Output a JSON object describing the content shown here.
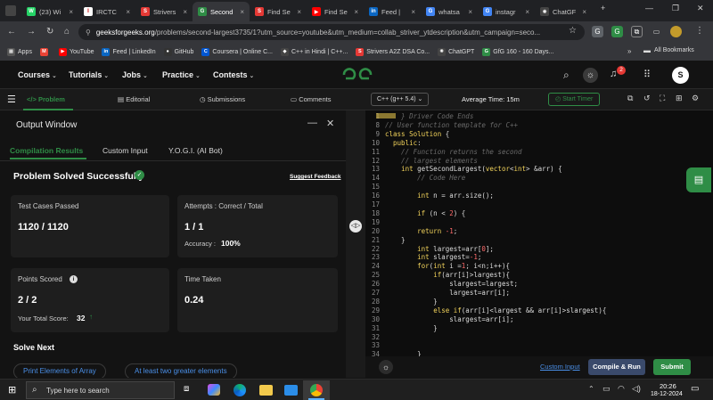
{
  "browser": {
    "tabs": [
      {
        "label": "(23) Wi",
        "color": "#25d366",
        "glyph": "W"
      },
      {
        "label": "IRCTC",
        "color": "#ffffff",
        "glyph": "I"
      },
      {
        "label": "Strivers",
        "color": "#e53935",
        "glyph": "S"
      },
      {
        "label": "Second",
        "color": "#2f8d46",
        "glyph": "G",
        "active": true
      },
      {
        "label": "Find Se",
        "color": "#e53935",
        "glyph": "S"
      },
      {
        "label": "Find Se",
        "color": "#ff0000",
        "glyph": "▶"
      },
      {
        "label": "Feed | ",
        "color": "#0a66c2",
        "glyph": "in"
      },
      {
        "label": "whatsa",
        "color": "#4285f4",
        "glyph": "G"
      },
      {
        "label": "instagr",
        "color": "#4285f4",
        "glyph": "G"
      },
      {
        "label": "ChatGF",
        "color": "#444444",
        "glyph": "✺"
      }
    ],
    "url_domain": "geeksforgeeks.org",
    "url_rest": "/problems/second-largest3735/1?utm_source=youtube&utm_medium=collab_striver_ytdescription&utm_campaign=seco...",
    "bookmarks": [
      {
        "label": "Apps",
        "color": "#555555",
        "glyph": "▦"
      },
      {
        "label": "",
        "color": "#ea4335",
        "glyph": "M"
      },
      {
        "label": "YouTube",
        "color": "#ff0000",
        "glyph": "▶"
      },
      {
        "label": "Feed | LinkedIn",
        "color": "#0a66c2",
        "glyph": "in"
      },
      {
        "label": "GitHub",
        "color": "#333333",
        "glyph": "●"
      },
      {
        "label": "Coursera | Online C...",
        "color": "#0056d2",
        "glyph": "C"
      },
      {
        "label": "C++ in Hindi | C++...",
        "color": "#444444",
        "glyph": "◆"
      },
      {
        "label": "Strivers A2Z DSA Co...",
        "color": "#e53935",
        "glyph": "S"
      },
      {
        "label": "ChatGPT",
        "color": "#444444",
        "glyph": "✺"
      },
      {
        "label": "GfG 160 - 160 Days...",
        "color": "#2f8d46",
        "glyph": "G"
      }
    ],
    "all_bookmarks": "All Bookmarks"
  },
  "gfg_header": {
    "menus": [
      "Courses",
      "Tutorials",
      "Jobs",
      "Practice",
      "Contests"
    ],
    "logo": "GG",
    "notif_count": "2",
    "avatar": "S"
  },
  "toolbar": {
    "problem": "Problem",
    "editorial": "Editorial",
    "submissions": "Submissions",
    "comments": "Comments",
    "language": "C++ (g++ 5.4)",
    "avg_time": "Average Time: 15m",
    "start_timer": "Start Timer"
  },
  "output": {
    "title": "Output Window",
    "tabs": [
      "Compilation Results",
      "Custom Input",
      "Y.O.G.I. (AI Bot)"
    ],
    "status": "Problem Solved Successfully",
    "suggest": "Suggest Feedback",
    "tests_label": "Test Cases Passed",
    "tests_value": "1120 / 1120",
    "attempts_label": "Attempts : Correct / Total",
    "attempts_value": "1 / 1",
    "accuracy_label": "Accuracy :",
    "accuracy_value": "100%",
    "points_label": "Points Scored",
    "points_value": "2 / 2",
    "total_label": "Your Total Score:",
    "total_value": "32",
    "time_label": "Time Taken",
    "time_value": "0.24",
    "solve_next": "Solve Next",
    "next_items": [
      "Print Elements of Array",
      "At least two greater elements"
    ]
  },
  "editor": {
    "lines": [
      {
        "n": "1",
        "text": "    } Driver Code Ends"
      },
      {
        "n": "8",
        "text": "// User function template for C++"
      },
      {
        "n": "9",
        "text": "class Solution {"
      },
      {
        "n": "10",
        "text": "  public:"
      },
      {
        "n": "11",
        "text": "    // Function returns the second"
      },
      {
        "n": "12",
        "text": "    // largest elements"
      },
      {
        "n": "13",
        "text": "    int getSecondLargest(vector<int> &arr) {"
      },
      {
        "n": "14",
        "text": "        // Code Here"
      },
      {
        "n": "15",
        "text": ""
      },
      {
        "n": "16",
        "text": "        int n = arr.size();"
      },
      {
        "n": "17",
        "text": ""
      },
      {
        "n": "18",
        "text": "        if (n < 2) {"
      },
      {
        "n": "19",
        "text": ""
      },
      {
        "n": "20",
        "text": "        return -1;"
      },
      {
        "n": "21",
        "text": "    }"
      },
      {
        "n": "22",
        "text": "        int largest=arr[0];"
      },
      {
        "n": "23",
        "text": "        int slargest=-1;"
      },
      {
        "n": "24",
        "text": "        for(int i =1; i<n;i++){"
      },
      {
        "n": "25",
        "text": "            if(arr[i]>largest){"
      },
      {
        "n": "26",
        "text": "                slargest=largest;"
      },
      {
        "n": "27",
        "text": "                largest=arr[i];"
      },
      {
        "n": "28",
        "text": "            }"
      },
      {
        "n": "29",
        "text": "            else if(arr[i]<largest && arr[i]>slargest){"
      },
      {
        "n": "30",
        "text": "                slargest=arr[i];"
      },
      {
        "n": "31",
        "text": "            }"
      },
      {
        "n": "32",
        "text": ""
      },
      {
        "n": "33",
        "text": ""
      },
      {
        "n": "34",
        "text": "        }"
      }
    ],
    "custom_input": "Custom Input",
    "compile_run": "Compile & Run",
    "submit": "Submit"
  },
  "taskbar": {
    "search_placeholder": "Type here to search",
    "time": "20:26",
    "date": "18-12-2024"
  }
}
